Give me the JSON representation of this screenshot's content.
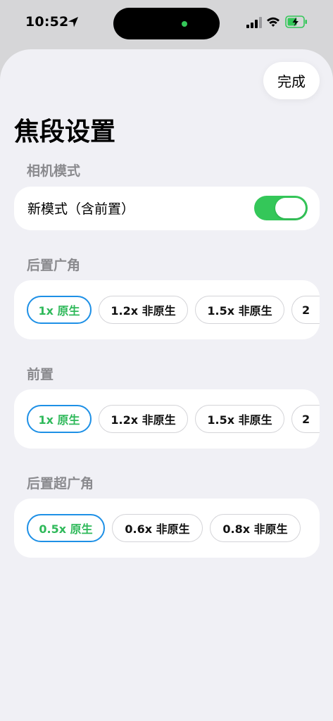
{
  "status_bar": {
    "time": "10:52",
    "island_indicator_color": "#34c759"
  },
  "done_label": "完成",
  "title": "焦段设置",
  "sections": [
    {
      "header": "相机模式",
      "toggle": {
        "label": "新模式（含前置）",
        "on": true
      }
    },
    {
      "header": "后置广角",
      "options": [
        {
          "label": "1x 原生",
          "selected": true
        },
        {
          "label": "1.2x 非原生",
          "selected": false
        },
        {
          "label": "1.5x 非原生",
          "selected": false
        },
        {
          "label": "2",
          "selected": false
        }
      ]
    },
    {
      "header": "前置",
      "options": [
        {
          "label": "1x 原生",
          "selected": true
        },
        {
          "label": "1.2x 非原生",
          "selected": false
        },
        {
          "label": "1.5x 非原生",
          "selected": false
        },
        {
          "label": "2",
          "selected": false
        }
      ]
    },
    {
      "header": "后置超广角",
      "options": [
        {
          "label": "0.5x 原生",
          "selected": true
        },
        {
          "label": "0.6x 非原生",
          "selected": false
        },
        {
          "label": "0.8x 非原生",
          "selected": false
        }
      ]
    }
  ],
  "colors": {
    "accent_green": "#34c759",
    "selected_border": "#1e90e6",
    "selected_text": "#2fb95a",
    "background": "#f0f0f5"
  }
}
